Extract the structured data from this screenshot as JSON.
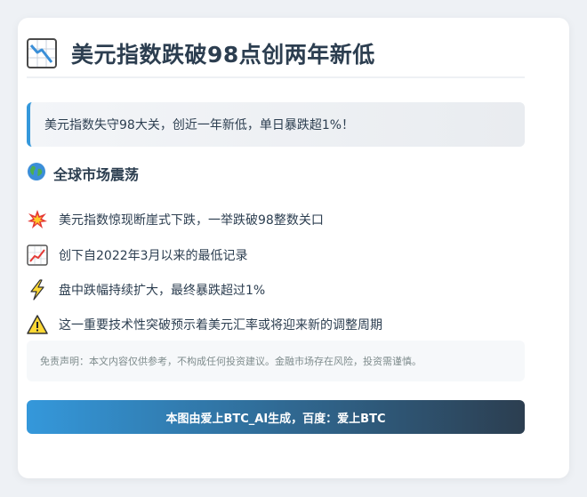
{
  "header": {
    "title": "美元指数跌破98点创两年新低",
    "icon": "chart-decreasing-icon"
  },
  "banner": {
    "text": "美元指数失守98大关，创近一年新低，单日暴跌超1%！"
  },
  "section": {
    "title": "全球市场震荡",
    "icon": "globe-icon"
  },
  "items": [
    {
      "icon": "collision-icon",
      "text": "美元指数惊现断崖式下跌，一举跌破98整数关口"
    },
    {
      "icon": "chart-increasing-icon",
      "text": "创下自2022年3月以来的最低记录"
    },
    {
      "icon": "lightning-icon",
      "text": "盘中跌幅持续扩大，最终暴跌超过1%"
    },
    {
      "icon": "warning-icon",
      "text": "这一重要技术性突破预示着美元汇率或将迎来新的调整周期"
    }
  ],
  "disclaimer": {
    "text": "免责声明：本文内容仅供参考，不构成任何投资建议。金融市场存在风险，投资需谨慎。"
  },
  "footer": {
    "text": "本图由爱上BTC_AI生成，百度：爱上BTC"
  },
  "colors": {
    "accent": "#3498db",
    "dark": "#2c3e50",
    "muted": "#7f8c8d"
  }
}
